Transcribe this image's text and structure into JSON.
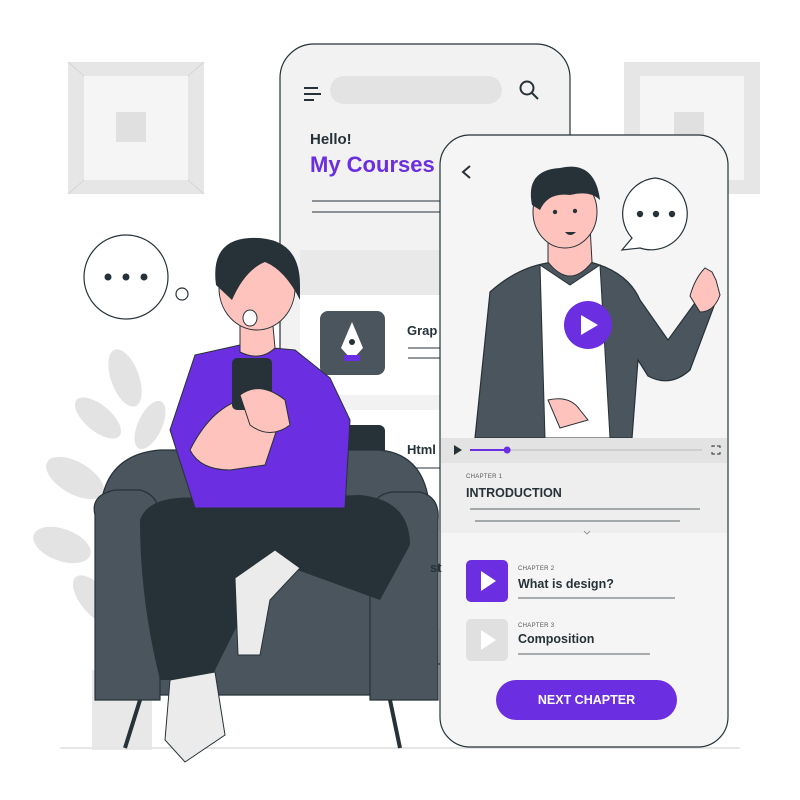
{
  "back_phone": {
    "greeting": "Hello!",
    "title": "My Courses",
    "courses": [
      {
        "label": "Grap"
      },
      {
        "label": "Html"
      },
      {
        "label": "st"
      }
    ]
  },
  "front_phone": {
    "chapters": [
      {
        "label": "CHAPTER 1",
        "title": "INTRODUCTION"
      },
      {
        "label": "CHAPTER 2",
        "title": "What is design?"
      },
      {
        "label": "CHAPTER 3",
        "title": "Composition"
      }
    ],
    "next_button": "NEXT CHAPTER",
    "video_progress": 0.16
  },
  "colors": {
    "accent": "#6b2ee0",
    "dark": "#263238",
    "chair": "#4a555e",
    "suit": "#4a555e",
    "light_gray": "#ebebeb"
  }
}
